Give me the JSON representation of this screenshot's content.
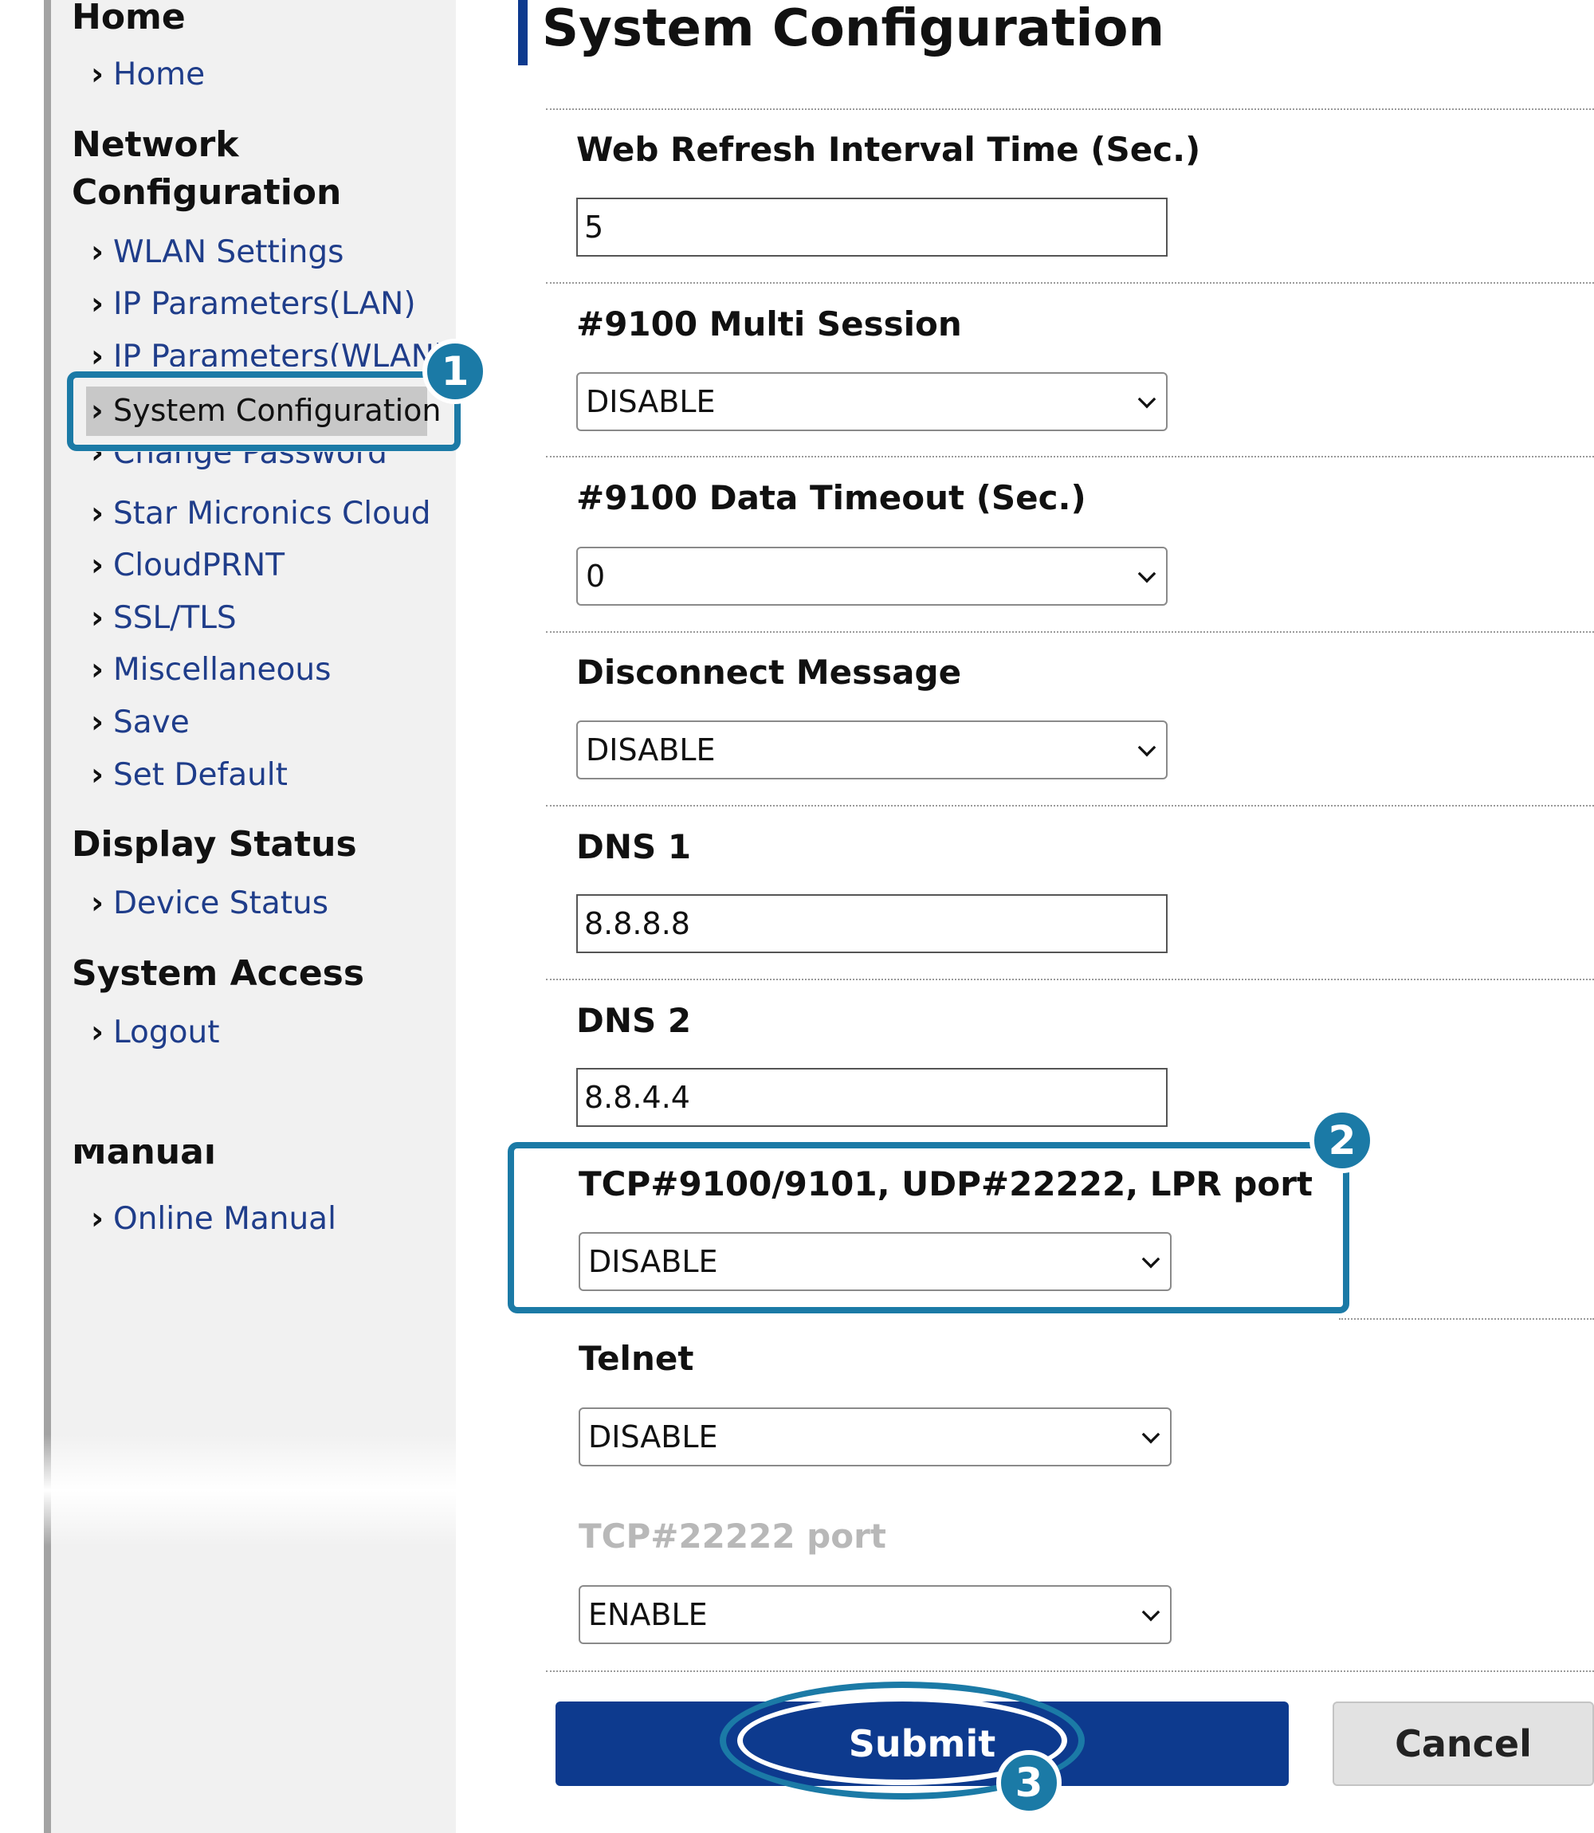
{
  "sidebar": {
    "sections": {
      "home": {
        "title": "Home",
        "items": [
          "Home"
        ]
      },
      "network": {
        "title_line1": "Network",
        "title_line2": "Configuration",
        "items": [
          "WLAN Settings",
          "IP Parameters(LAN)",
          "IP Parameters(WLAN)",
          "System Configuration",
          "Change Password",
          "Star Micronics Cloud",
          "CloudPRNT",
          "SSL/TLS",
          "Miscellaneous",
          "Save",
          "Set Default"
        ]
      },
      "display": {
        "title": "Display Status",
        "items": [
          "Device Status"
        ]
      },
      "access": {
        "title": "System Access",
        "items": [
          "Logout"
        ]
      },
      "manual": {
        "title": "Manual",
        "items": [
          "Online Manual"
        ]
      }
    },
    "chevron": "›"
  },
  "main": {
    "title": "System Configuration",
    "fields": [
      {
        "label": "Web Refresh Interval Time (Sec.)",
        "type": "text",
        "value": "5"
      },
      {
        "label": "#9100 Multi Session",
        "type": "select",
        "value": "DISABLE"
      },
      {
        "label": "#9100 Data Timeout (Sec.)",
        "type": "select",
        "value": "0"
      },
      {
        "label": "Disconnect Message",
        "type": "select",
        "value": "DISABLE"
      },
      {
        "label": "DNS 1",
        "type": "text",
        "value": "8.8.8.8"
      },
      {
        "label": "DNS 2",
        "type": "text",
        "value": "8.8.4.4"
      },
      {
        "label": "TCP#9100/9101, UDP#22222, LPR port",
        "type": "select",
        "value": "DISABLE"
      },
      {
        "label": "Telnet",
        "type": "select",
        "value": "DISABLE"
      },
      {
        "label": "TCP#22222 port",
        "type": "select",
        "value": "ENABLE"
      }
    ],
    "submit_label": "Submit",
    "cancel_label": "Cancel"
  },
  "annotations": {
    "badge1": "1",
    "badge2": "2",
    "badge3": "3",
    "color": "#1b7aa6"
  },
  "colors": {
    "accent": "#0d3a8e",
    "link": "#1f3d8a",
    "sidebar_bg": "#f1f1f1"
  }
}
